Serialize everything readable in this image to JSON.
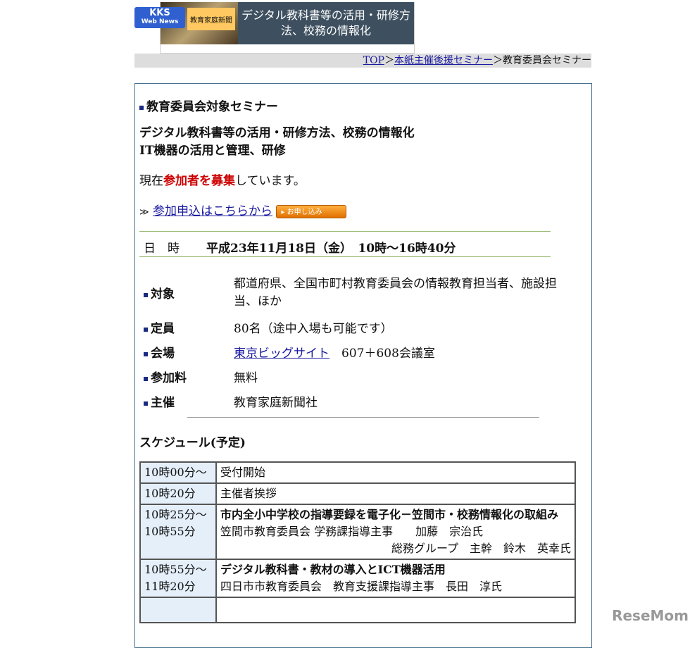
{
  "banner": {
    "logo_line1": "KKS",
    "logo_line2": "Web News",
    "paper": "教育家庭新聞",
    "title_line1": "デジタル教科書等の活用・研修方",
    "title_line2": "法、校務の情報化"
  },
  "breadcrumb": {
    "top": "TOP",
    "sep": "＞",
    "parent": "本紙主催後援セミナー",
    "current": "教育委員会セミナー"
  },
  "heading": "教育委員会対象セミナー",
  "subtitle1": "デジタル教科書等の活用・研修方法、校務の情報化",
  "subtitle2": "IT機器の活用と管理、研修",
  "recruit": {
    "pre": "現在",
    "em": "参加者を募集",
    "post": "しています。"
  },
  "apply": {
    "arrow": "≫",
    "link": "参加申込はこちらから",
    "button": "▸ お申し込み"
  },
  "datetime": {
    "label": "日　時",
    "value": "平成23年11月18日（金）　10時〜16時40分"
  },
  "info": [
    {
      "label": "対象",
      "value": "都道府県、全国市町村教育委員会の情報教育担当者、施設担当、ほか"
    },
    {
      "label": "定員",
      "value": "80名（途中入場も可能です）"
    },
    {
      "label": "会場",
      "link": "東京ビッグサイト",
      "value": "607＋608会議室"
    },
    {
      "label": "参加料",
      "value": "無料"
    },
    {
      "label": "主催",
      "value": "教育家庭新聞社"
    }
  ],
  "schedule_title": "スケジュール(予定)",
  "schedule": [
    {
      "time": "10時00分〜",
      "title": "受付開始"
    },
    {
      "time": "10時20分",
      "title": "主催者挨拶"
    },
    {
      "time": "10時25分〜",
      "time2": "10時55分",
      "title": "市内全小中学校の指導要録を電子化－笠間市・校務情報化の取組み",
      "bold": true,
      "speaker": "笠間市教育委員会 学務課指導主事　　加藤　宗治氏",
      "speaker2": "総務グループ　主幹　鈴木　英幸氏"
    },
    {
      "time": "10時55分〜",
      "time2": "11時20分",
      "title": "デジタル教科書・教材の導入とICT機器活用",
      "bold": true,
      "speaker": "四日市市教育委員会　教育支援課指導主事　長田　淳氏"
    }
  ],
  "watermark": "ReseMom"
}
